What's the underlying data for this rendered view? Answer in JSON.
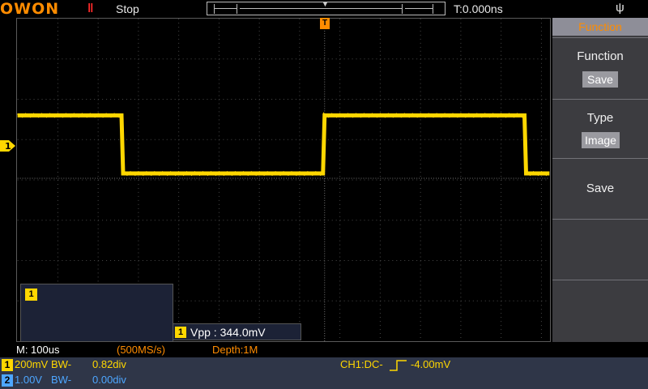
{
  "header": {
    "brand": "OWON",
    "run_icon": "pause-icon",
    "run_state": "Stop",
    "time_offset": "T:0.000ns",
    "usb_icon": "usb-icon"
  },
  "markers": {
    "trigger_label": "T",
    "ch1_label": "1"
  },
  "menu": {
    "title": "Function",
    "items": [
      {
        "label": "Function",
        "value": "Save"
      },
      {
        "label": "Type",
        "value": "Image"
      },
      {
        "label": "Save",
        "value": ""
      },
      {
        "label": "",
        "value": ""
      },
      {
        "label": "",
        "value": ""
      }
    ]
  },
  "math_window": {
    "channel": "1"
  },
  "measurement": {
    "channel": "1",
    "text": "Vpp : 344.0mV"
  },
  "status": {
    "timebase": "M: 100us",
    "sample_rate": "(500MS/s)",
    "depth": "Depth:1M",
    "ch1": {
      "num": "1",
      "scale": "200mV",
      "bw": "BW-",
      "pos": "0.82div"
    },
    "ch2": {
      "num": "2",
      "scale": "1.00V",
      "bw": "BW-",
      "pos": "0.00div"
    },
    "trigger": {
      "prefix": "CH1:DC-",
      "level": "-4.00mV"
    }
  },
  "colors": {
    "ch1": "#ffd700",
    "ch2": "#4da6ff",
    "accent": "#ff8c00",
    "grid": "#4a4a4a"
  },
  "waveform": {
    "type": "square",
    "channel": "1",
    "high_level_div": 1.5,
    "low_level_div": 0.0,
    "transitions_div": [
      2.6,
      7.6,
      12.6
    ]
  }
}
